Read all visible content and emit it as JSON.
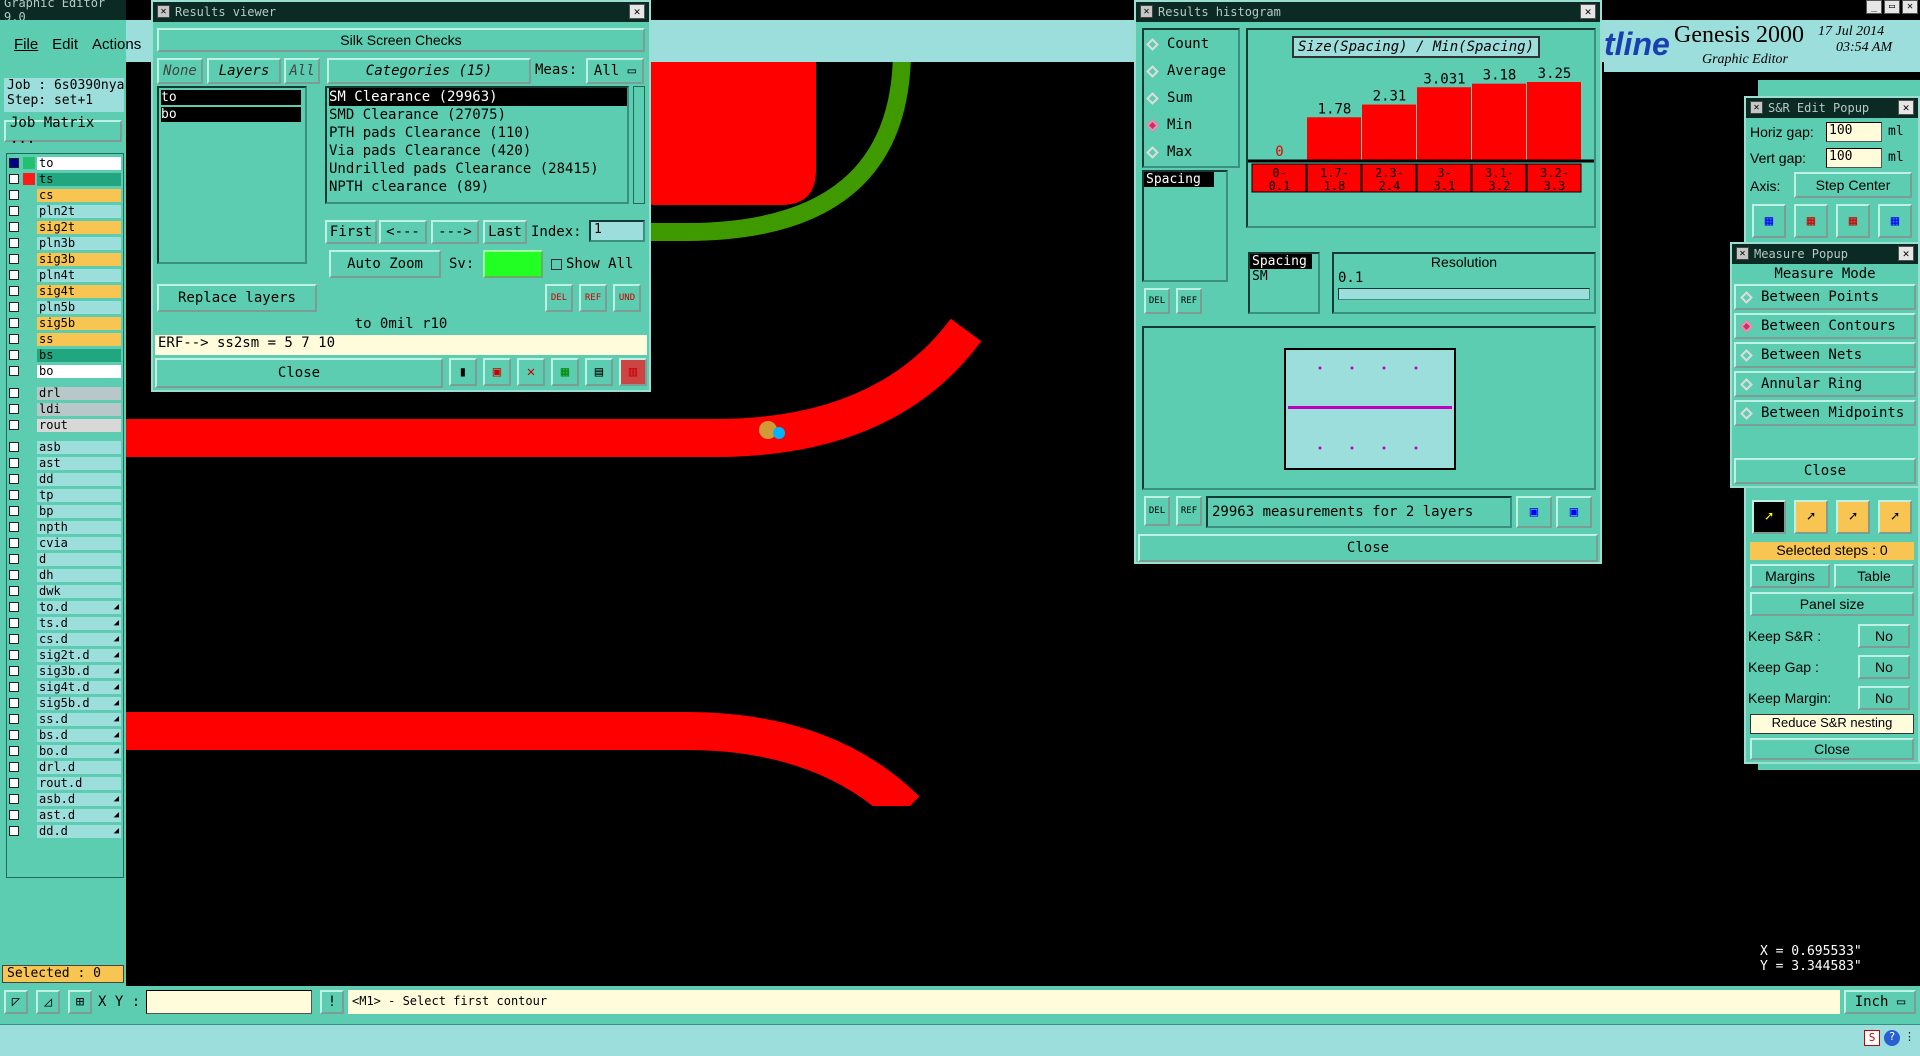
{
  "app": {
    "title": "Graphic Editor 9.0",
    "menu": [
      "File",
      "Edit",
      "Actions"
    ],
    "job": "Job : 6s0390nya0",
    "step": "Step: set+1",
    "job_matrix": "Job Matrix ...",
    "selected": "Selected : 0"
  },
  "layers": [
    {
      "name": "to",
      "color": "#ffffff",
      "sel": true
    },
    {
      "name": "ts",
      "color": "#21a67f"
    },
    {
      "name": "cs",
      "color": "#f8c552"
    },
    {
      "name": "pln2t",
      "color": "#9cdedc"
    },
    {
      "name": "sig2t",
      "color": "#f8c552"
    },
    {
      "name": "pln3b",
      "color": "#9cdedc"
    },
    {
      "name": "sig3b",
      "color": "#f8c552"
    },
    {
      "name": "pln4t",
      "color": "#9cdedc"
    },
    {
      "name": "sig4t",
      "color": "#f8c552"
    },
    {
      "name": "pln5b",
      "color": "#9cdedc"
    },
    {
      "name": "sig5b",
      "color": "#f8c552"
    },
    {
      "name": "ss",
      "color": "#f8c552"
    },
    {
      "name": "bs",
      "color": "#21a67f"
    },
    {
      "name": "bo",
      "color": "#ffffff"
    },
    {
      "name": "drl",
      "color": "#b8c8c8",
      "gap": true
    },
    {
      "name": "ldi",
      "color": "#b8c8c8"
    },
    {
      "name": "rout",
      "color": "#d8d8d8"
    },
    {
      "name": "asb",
      "color": "#9cdedc",
      "gap": true
    },
    {
      "name": "ast",
      "color": "#9cdedc"
    },
    {
      "name": "dd",
      "color": "#9cdedc"
    },
    {
      "name": "tp",
      "color": "#9cdedc"
    },
    {
      "name": "bp",
      "color": "#9cdedc"
    },
    {
      "name": "npth",
      "color": "#9cdedc"
    },
    {
      "name": "cvia",
      "color": "#9cdedc"
    },
    {
      "name": "d",
      "color": "#9cdedc"
    },
    {
      "name": "dh",
      "color": "#9cdedc"
    },
    {
      "name": "dwk",
      "color": "#9cdedc"
    },
    {
      "name": "to.d",
      "color": "#9cdedc",
      "mark": "◢"
    },
    {
      "name": "ts.d",
      "color": "#9cdedc",
      "mark": "◢"
    },
    {
      "name": "cs.d",
      "color": "#9cdedc",
      "mark": "◢"
    },
    {
      "name": "sig2t.d",
      "color": "#9cdedc",
      "mark": "◢"
    },
    {
      "name": "sig3b.d",
      "color": "#9cdedc",
      "mark": "◢"
    },
    {
      "name": "sig4t.d",
      "color": "#9cdedc",
      "mark": "◢"
    },
    {
      "name": "sig5b.d",
      "color": "#9cdedc",
      "mark": "◢"
    },
    {
      "name": "ss.d",
      "color": "#9cdedc",
      "mark": "◢"
    },
    {
      "name": "bs.d",
      "color": "#9cdedc",
      "mark": "◢"
    },
    {
      "name": "bo.d",
      "color": "#9cdedc",
      "mark": "◢"
    },
    {
      "name": "drl.d",
      "color": "#9cdedc"
    },
    {
      "name": "rout.d",
      "color": "#9cdedc"
    },
    {
      "name": "asb.d",
      "color": "#9cdedc",
      "mark": "◢"
    },
    {
      "name": "ast.d",
      "color": "#9cdedc",
      "mark": "◢"
    },
    {
      "name": "dd.d",
      "color": "#9cdedc",
      "mark": "◢"
    }
  ],
  "results": {
    "title": "Results viewer",
    "header": "Silk Screen Checks",
    "none": "None",
    "layers_label": "Layers",
    "all": "All",
    "categories": "Categories (15)",
    "meas": "Meas:",
    "meas_val": "All",
    "layer_list": [
      "to",
      "bo"
    ],
    "cat_list": [
      "SM Clearance (29963)",
      "SMD Clearance (27075)",
      "PTH pads Clearance (110)",
      "Via pads Clearance (420)",
      "Undrilled pads Clearance (28415)",
      "NPTH clearance (89)"
    ],
    "first": "First",
    "prev": "<---",
    "next": "--->",
    "last": "Last",
    "index": "Index:",
    "index_val": "1",
    "auto_zoom": "Auto Zoom",
    "sv": "Sv:",
    "show_all": "Show All",
    "replace": "Replace layers",
    "del": "DEL",
    "ref": "REF",
    "und": "UND",
    "info": "to 0mil  r10",
    "erf": "ERF--> ss2sm = 5 7 10",
    "close": "Close"
  },
  "histogram": {
    "title": "Results histogram",
    "heading": "Size(Spacing) / Min(Spacing)",
    "radios": [
      "Count",
      "Average",
      "Sum",
      "Min",
      "Max"
    ],
    "selected": "Min",
    "spacing": "Spacing",
    "spacing2": "Spacing",
    "sm": "SM",
    "resolution": "Resolution",
    "res_val": "0.1",
    "status": "29963 measurements for 2 layers",
    "close": "Close",
    "del": "DEL",
    "ref": "REF",
    "bars": [
      {
        "value": 0,
        "label": "0",
        "range": "0-\n0.1"
      },
      {
        "value": 1.78,
        "label": "1.78",
        "range": "1.7-\n1.8"
      },
      {
        "value": 2.31,
        "label": "2.31",
        "range": "2.3-\n2.4"
      },
      {
        "value": 3.031,
        "label": "3.031",
        "range": "3-\n3.1"
      },
      {
        "value": 3.18,
        "label": "3.18",
        "range": "3.1-\n3.2"
      },
      {
        "value": 3.25,
        "label": "3.25",
        "range": "3.2-\n3.3"
      }
    ],
    "bar_max": 3.25,
    "bar_color": "#ff0000"
  },
  "brand": {
    "logo": "tline",
    "product": "Genesis 2000",
    "sub": "Graphic Editor",
    "date": "17 Jul 2014",
    "time": "03:54 AM"
  },
  "sr": {
    "title": "S&R Edit Popup",
    "hgap": "Horiz gap:",
    "hval": "100",
    "vgap": "Vert  gap:",
    "vval": "100",
    "unit": "ml",
    "axis": "Axis:",
    "axis_val": "Step Center",
    "steps": "Selected steps : 0",
    "margins": "Margins",
    "table": "Table",
    "panel": "Panel size",
    "keep_sr": "Keep S&R  :",
    "keep_gap": "Keep Gap   :",
    "keep_margin": "Keep Margin:",
    "no": "No",
    "reduce": "Reduce S&R nesting",
    "close": "Close"
  },
  "measure": {
    "title": "Measure Popup",
    "mode": "Measure Mode",
    "items": [
      "Between Points",
      "Between Contours",
      "Between Nets",
      "Annular Ring",
      "Between Midpoints"
    ],
    "selected": "Between Contours",
    "close": "Close"
  },
  "status": {
    "xy": "X Y :",
    "xy_val": "",
    "prompt": "<M1> - Select first contour",
    "units": "Inch",
    "coord_x": "X = 0.695533\"",
    "coord_y": "Y = 3.344583\""
  },
  "colors": {
    "trace": "#ff0000",
    "green_trace": "#3f9a00",
    "panel": "#5ccdb0"
  }
}
